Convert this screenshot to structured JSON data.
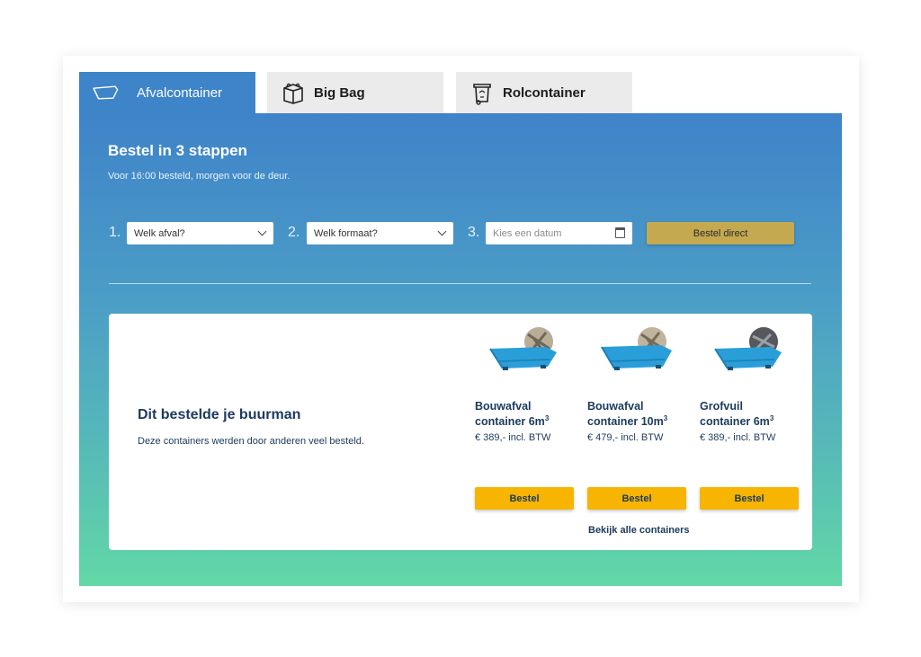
{
  "tabs": [
    {
      "label": "Afvalcontainer",
      "icon": "skip-container-icon",
      "active": true
    },
    {
      "label": "Big Bag",
      "icon": "big-bag-icon",
      "active": false
    },
    {
      "label": "Rolcontainer",
      "icon": "wheelie-bin-icon",
      "active": false
    }
  ],
  "order": {
    "title": "Bestel in 3 stappen",
    "subtitle": "Voor 16:00 besteld, morgen voor de deur.",
    "steps": [
      {
        "number": "1.",
        "value": "Welk afval?"
      },
      {
        "number": "2.",
        "value": "Welk formaat?"
      },
      {
        "number": "3.",
        "placeholder": "Kies een datum"
      }
    ],
    "submit_label": "Bestel direct"
  },
  "neighbour": {
    "title": "Dit bestelde je buurman",
    "subtitle": "Deze containers werden door anderen veel besteld.",
    "products": [
      {
        "name_line1": "Bouwafval",
        "name_line2": "container 6m",
        "sup": "3",
        "price": "€ 389,- incl. BTW",
        "button": "Bestel"
      },
      {
        "name_line1": "Bouwafval",
        "name_line2": "container 10m",
        "sup": "3",
        "price": "€ 479,- incl. BTW",
        "button": "Bestel"
      },
      {
        "name_line1": "Grofvuil",
        "name_line2": "container 6m",
        "sup": "3",
        "price": "€ 389,- incl. BTW",
        "button": "Bestel"
      }
    ],
    "all_link": "Bekijk alle containers"
  },
  "colors": {
    "tab_active": "#3e84c8",
    "gradient_top": "#3f83c9",
    "gradient_bottom": "#62d8a6",
    "submit_button": "#c4a950",
    "bestel_button": "#f7b400",
    "navy_text": "#1d3a5c"
  }
}
